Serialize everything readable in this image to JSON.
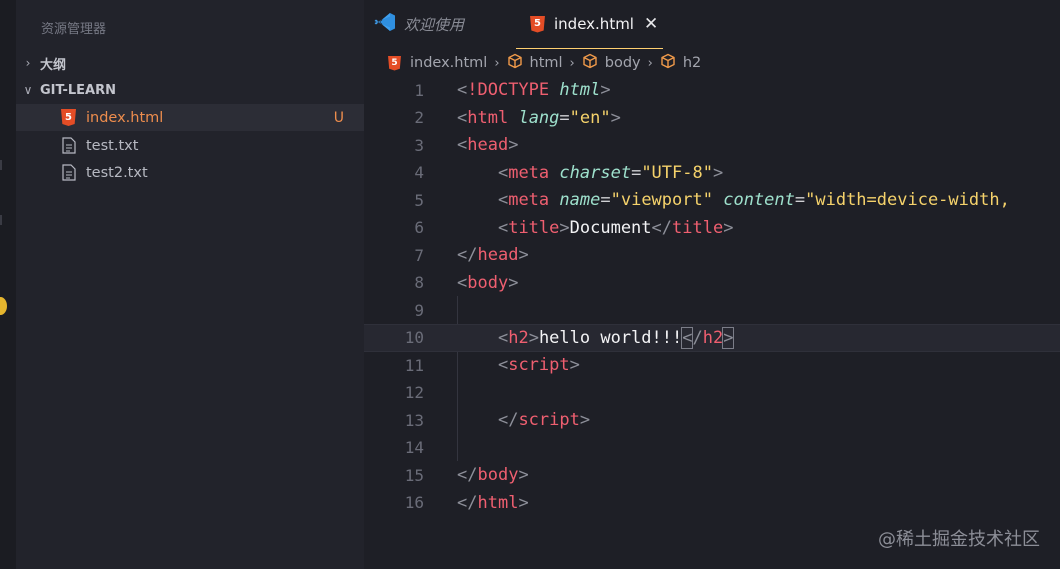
{
  "sidebar": {
    "title": "资源管理器",
    "outline_label": "大纲",
    "folder_label": "GIT-LEARN",
    "files": [
      {
        "name": "index.html",
        "icon": "html5-icon",
        "badge": "U",
        "active": true
      },
      {
        "name": "test.txt",
        "icon": "file-icon",
        "badge": "",
        "active": false
      },
      {
        "name": "test2.txt",
        "icon": "file-icon",
        "badge": "",
        "active": false
      }
    ]
  },
  "tabs": [
    {
      "label": "欢迎使用",
      "icon": "vscode-icon",
      "active": false
    },
    {
      "label": "index.html",
      "icon": "html5-icon",
      "active": true,
      "close": "✕"
    }
  ],
  "breadcrumb": {
    "file": "index.html",
    "items": [
      "html",
      "body",
      "h2"
    ],
    "separator": "›"
  },
  "editor": {
    "line_numbers": [
      "1",
      "2",
      "3",
      "4",
      "5",
      "6",
      "7",
      "8",
      "9",
      "10",
      "11",
      "12",
      "13",
      "14",
      "15",
      "16"
    ],
    "current_line": "10",
    "lines": [
      [
        [
          "p",
          "<"
        ],
        [
          "k",
          "!DOCTYPE"
        ],
        [
          "x",
          " "
        ],
        [
          "i",
          "html"
        ],
        [
          "p",
          ">"
        ]
      ],
      [
        [
          "p",
          "<"
        ],
        [
          "k",
          "html"
        ],
        [
          "x",
          " "
        ],
        [
          "a",
          "lang"
        ],
        [
          "e",
          "="
        ],
        [
          "s",
          "\"en\""
        ],
        [
          "p",
          ">"
        ]
      ],
      [
        [
          "p",
          "<"
        ],
        [
          "k",
          "head"
        ],
        [
          "p",
          ">"
        ]
      ],
      [
        [
          "x",
          "    "
        ],
        [
          "p",
          "<"
        ],
        [
          "k",
          "meta"
        ],
        [
          "x",
          " "
        ],
        [
          "a",
          "charset"
        ],
        [
          "e",
          "="
        ],
        [
          "s",
          "\"UTF-8\""
        ],
        [
          "p",
          ">"
        ]
      ],
      [
        [
          "x",
          "    "
        ],
        [
          "p",
          "<"
        ],
        [
          "k",
          "meta"
        ],
        [
          "x",
          " "
        ],
        [
          "a",
          "name"
        ],
        [
          "e",
          "="
        ],
        [
          "s",
          "\"viewport\""
        ],
        [
          "x",
          " "
        ],
        [
          "a",
          "content"
        ],
        [
          "e",
          "="
        ],
        [
          "s",
          "\"width=device-width,"
        ]
      ],
      [
        [
          "x",
          "    "
        ],
        [
          "p",
          "<"
        ],
        [
          "k",
          "title"
        ],
        [
          "p",
          ">"
        ],
        [
          "t",
          "Document"
        ],
        [
          "p",
          "</"
        ],
        [
          "k",
          "title"
        ],
        [
          "p",
          ">"
        ]
      ],
      [
        [
          "p",
          "</"
        ],
        [
          "k",
          "head"
        ],
        [
          "p",
          ">"
        ]
      ],
      [
        [
          "p",
          "<"
        ],
        [
          "k",
          "body"
        ],
        [
          "p",
          ">"
        ]
      ],
      [],
      [
        [
          "x",
          "    "
        ],
        [
          "p",
          "<"
        ],
        [
          "k",
          "h2"
        ],
        [
          "p",
          ">"
        ],
        [
          "t",
          "hello world!!!"
        ],
        [
          "b",
          "<"
        ],
        [
          "p",
          "/"
        ],
        [
          "k",
          "h2"
        ],
        [
          "b",
          ">"
        ]
      ],
      [
        [
          "x",
          "    "
        ],
        [
          "p",
          "<"
        ],
        [
          "k",
          "script"
        ],
        [
          "p",
          ">"
        ]
      ],
      [],
      [
        [
          "x",
          "    "
        ],
        [
          "p",
          "</"
        ],
        [
          "k",
          "script"
        ],
        [
          "p",
          ">"
        ]
      ],
      [],
      [
        [
          "p",
          "</"
        ],
        [
          "k",
          "body"
        ],
        [
          "p",
          ">"
        ]
      ],
      [
        [
          "p",
          "</"
        ],
        [
          "k",
          "html"
        ],
        [
          "p",
          ">"
        ]
      ]
    ]
  },
  "watermark": "@稀土掘金技术社区",
  "colors": {
    "background": "#1e1f26",
    "sidebar": "#22232b",
    "tag": "#ef5f70",
    "attribute": "#9ee0cc",
    "string": "#f5d26b",
    "active_file": "#ee8d4d",
    "tab_underline": "#ffd070"
  }
}
